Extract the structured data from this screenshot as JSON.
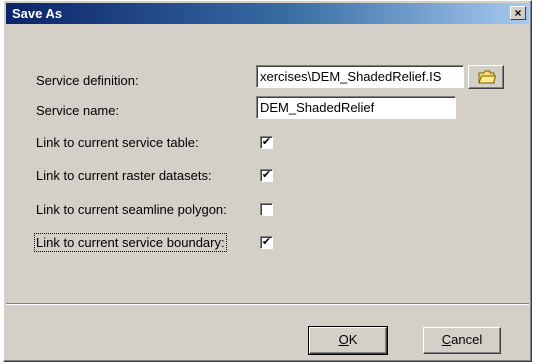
{
  "dialog": {
    "title": "Save As",
    "close_symbol": "×"
  },
  "fields": {
    "service_definition_label": "Service definition:",
    "service_definition_value": "xercises\\DEM_ShadedRelief.IS",
    "service_name_label": "Service name:",
    "service_name_value": "DEM_ShadedRelief"
  },
  "options": [
    {
      "label": "Link to current service table:",
      "checked": true
    },
    {
      "label": "Link to current raster datasets:",
      "checked": true
    },
    {
      "label": "Link to current seamline polygon:",
      "checked": false
    },
    {
      "label": "Link to current service boundary:",
      "checked": true
    }
  ],
  "buttons": {
    "ok_mnemonic": "O",
    "ok_rest": "K",
    "cancel_mnemonic": "C",
    "cancel_rest": "ancel"
  },
  "icons": {
    "browse": "folder-icon",
    "close": "close-icon"
  },
  "colors": {
    "titlebar_start": "#0a246a",
    "titlebar_end": "#a6caf0",
    "dialog_bg": "#d4d0c8"
  }
}
